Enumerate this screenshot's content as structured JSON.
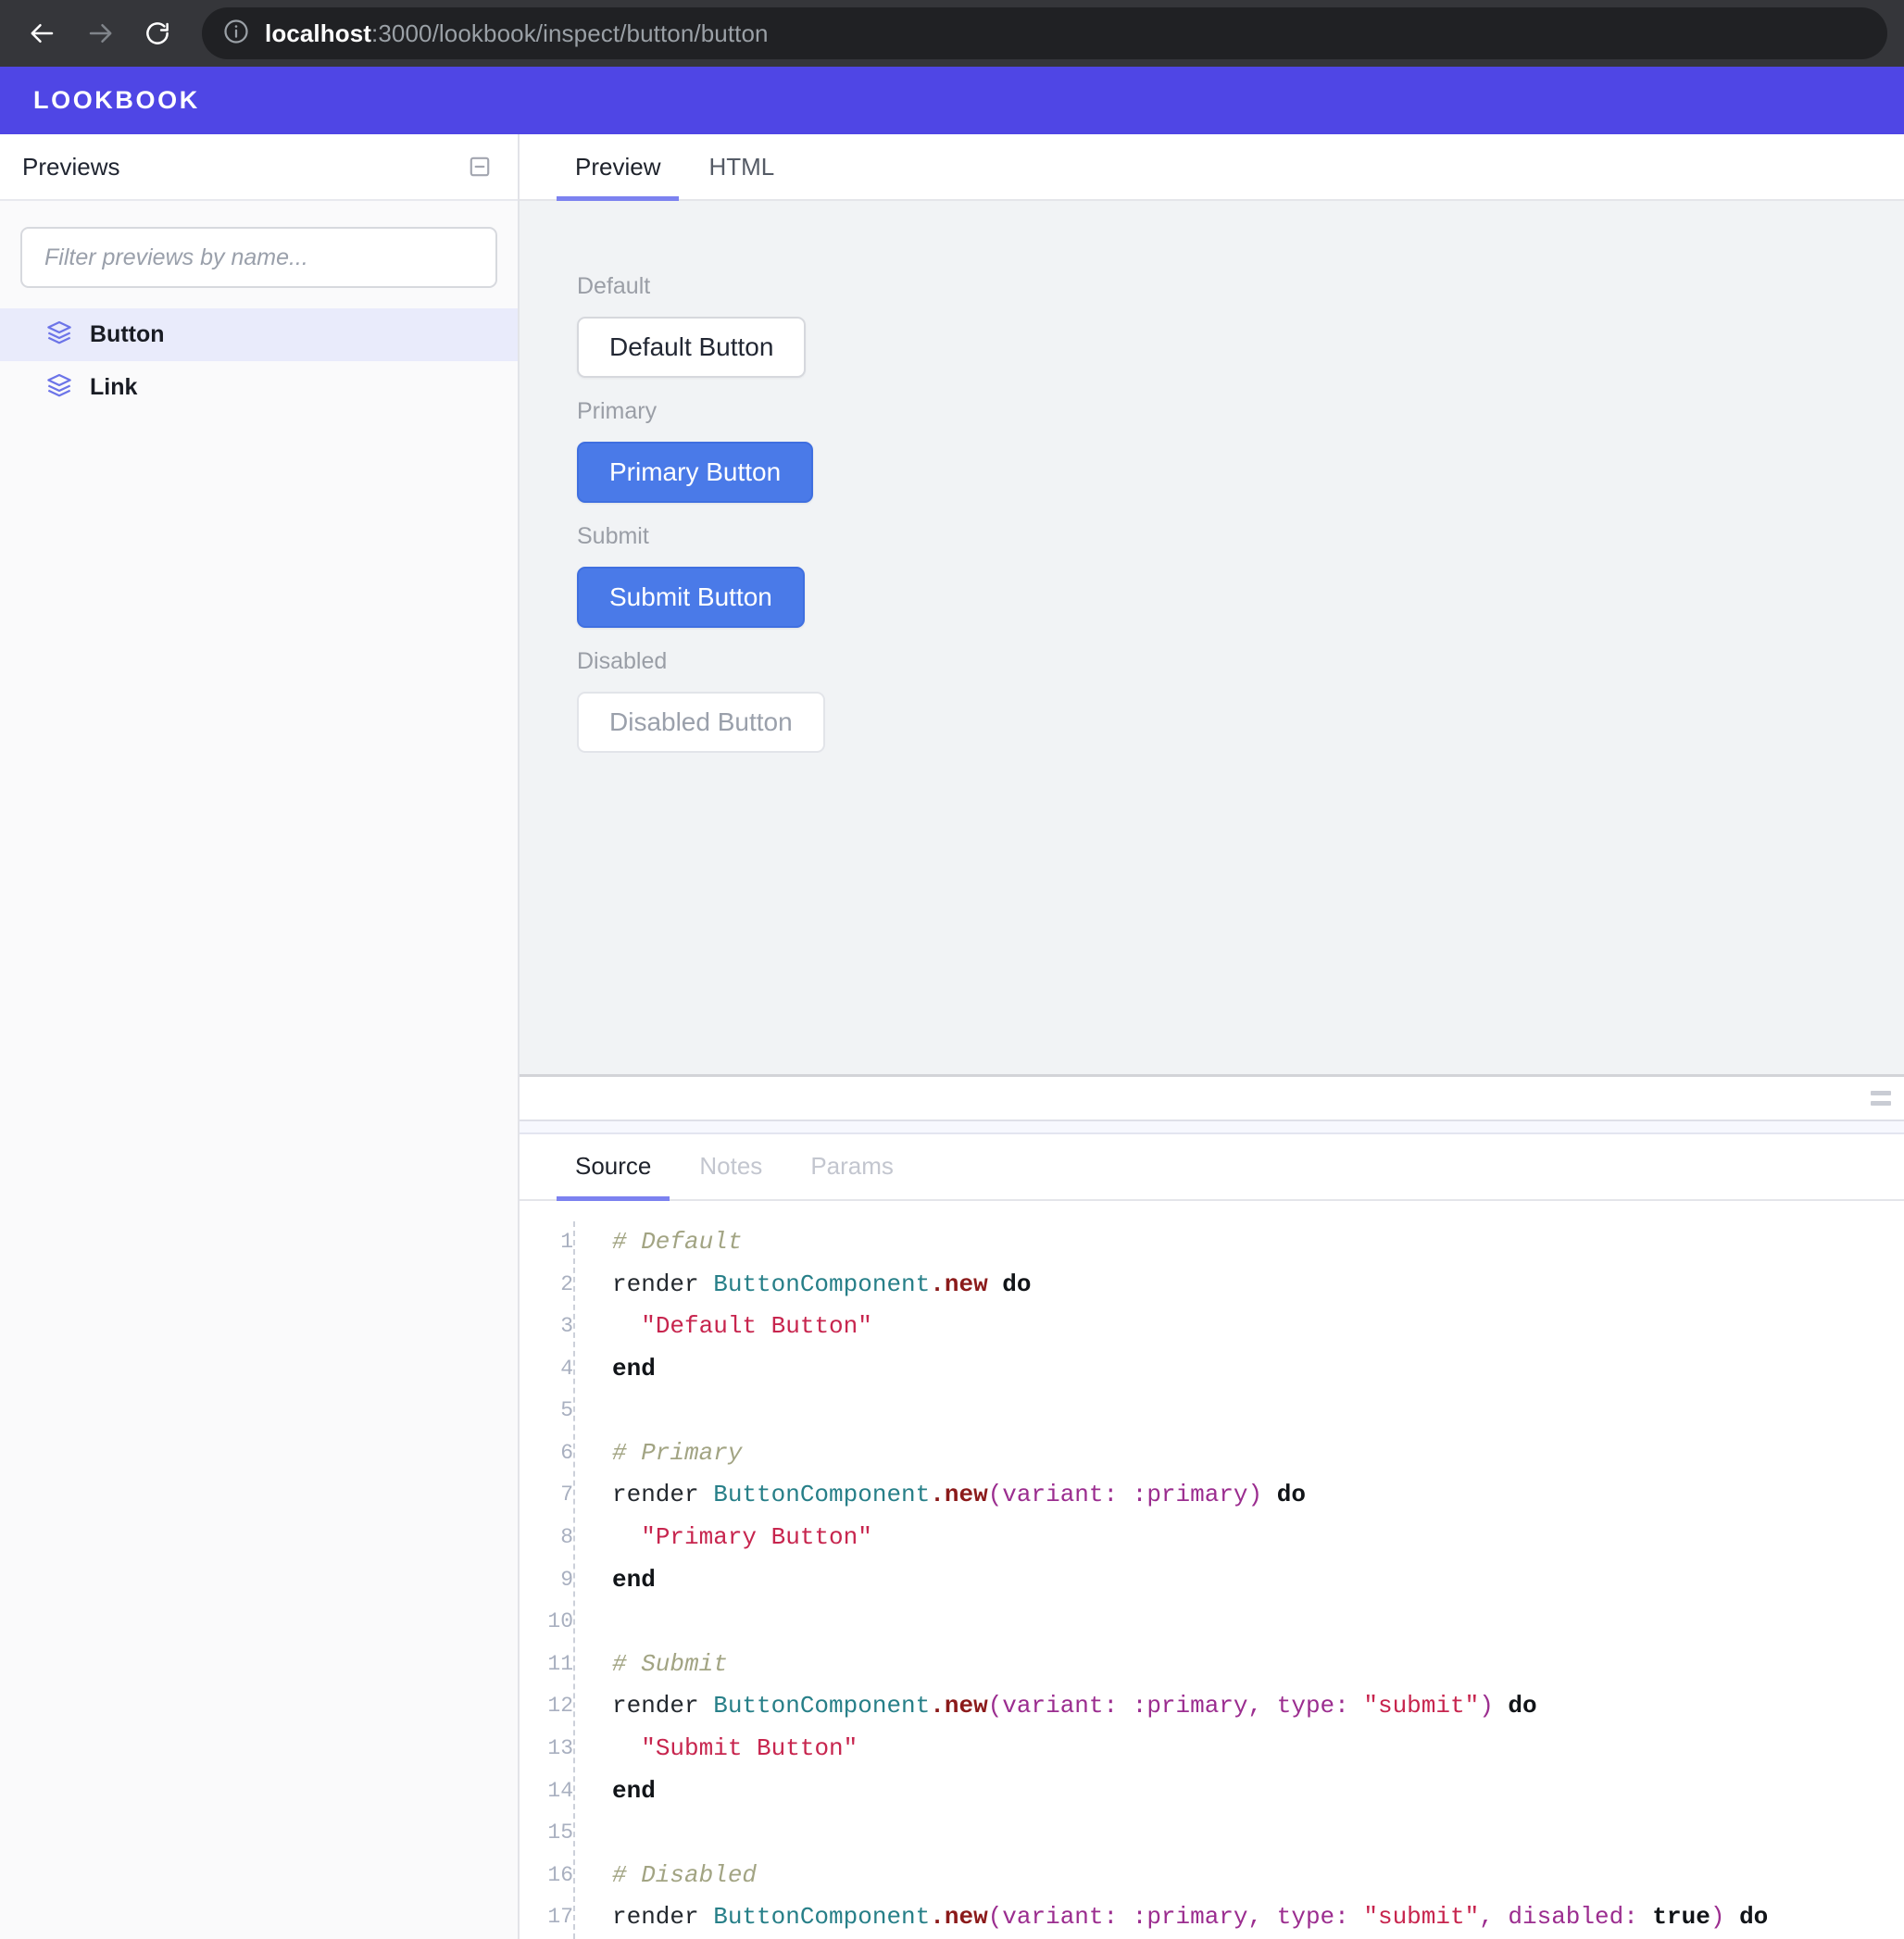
{
  "browser": {
    "back_icon": "arrow-left-icon",
    "forward_icon": "arrow-right-icon",
    "reload_icon": "reload-icon",
    "info_icon": "info-circle-icon",
    "url_host": "localhost",
    "url_rest": ":3000/lookbook/inspect/button/button"
  },
  "header": {
    "brand": "LOOKBOOK",
    "brand_color": "#4f46e5"
  },
  "sidebar": {
    "title": "Previews",
    "collapse_icon": "collapse-square-minus-icon",
    "filter_placeholder": "Filter previews by name...",
    "filter_value": "",
    "items": [
      {
        "label": "Button",
        "icon": "layers-icon",
        "active": true
      },
      {
        "label": "Link",
        "icon": "layers-icon",
        "active": false
      }
    ]
  },
  "main": {
    "tabs": [
      {
        "label": "Preview",
        "active": true
      },
      {
        "label": "HTML",
        "active": false
      }
    ],
    "previews": [
      {
        "label": "Default",
        "button_text": "Default Button",
        "style": "default"
      },
      {
        "label": "Primary",
        "button_text": "Primary Button",
        "style": "primary"
      },
      {
        "label": "Submit",
        "button_text": "Submit Button",
        "style": "primary"
      },
      {
        "label": "Disabled",
        "button_text": "Disabled Button",
        "style": "disabled"
      }
    ],
    "preview_bg": "#f1f3f5",
    "primary_button_color": "#4a7ae8"
  },
  "drawer": {
    "tabs": [
      {
        "label": "Source",
        "active": true,
        "muted": false
      },
      {
        "label": "Notes",
        "active": false,
        "muted": true
      },
      {
        "label": "Params",
        "active": false,
        "muted": true
      }
    ],
    "resize_grip_icon": "resize-grip-icon",
    "code": {
      "language": "ruby",
      "line_numbers": [
        "1",
        "2",
        "3",
        "4",
        "5",
        "6",
        "7",
        "8",
        "9",
        "10",
        "11",
        "12",
        "13",
        "14",
        "15",
        "16",
        "17"
      ],
      "lines": [
        [
          {
            "t": "comment",
            "v": "# Default"
          }
        ],
        [
          {
            "t": "plain",
            "v": "render "
          },
          {
            "t": "const",
            "v": "ButtonComponent"
          },
          {
            "t": "dot",
            "v": "."
          },
          {
            "t": "method",
            "v": "new"
          },
          {
            "t": "plain",
            "v": " "
          },
          {
            "t": "kw",
            "v": "do"
          }
        ],
        [
          {
            "t": "plain",
            "v": "  "
          },
          {
            "t": "str",
            "v": "\"Default Button\""
          }
        ],
        [
          {
            "t": "kw",
            "v": "end"
          }
        ],
        [
          {
            "t": "plain",
            "v": ""
          }
        ],
        [
          {
            "t": "comment",
            "v": "# Primary"
          }
        ],
        [
          {
            "t": "plain",
            "v": "render "
          },
          {
            "t": "const",
            "v": "ButtonComponent"
          },
          {
            "t": "dot",
            "v": "."
          },
          {
            "t": "method",
            "v": "new"
          },
          {
            "t": "sym",
            "v": "(variant: :primary)"
          },
          {
            "t": "plain",
            "v": " "
          },
          {
            "t": "kw",
            "v": "do"
          }
        ],
        [
          {
            "t": "plain",
            "v": "  "
          },
          {
            "t": "str",
            "v": "\"Primary Button\""
          }
        ],
        [
          {
            "t": "kw",
            "v": "end"
          }
        ],
        [
          {
            "t": "plain",
            "v": ""
          }
        ],
        [
          {
            "t": "comment",
            "v": "# Submit"
          }
        ],
        [
          {
            "t": "plain",
            "v": "render "
          },
          {
            "t": "const",
            "v": "ButtonComponent"
          },
          {
            "t": "dot",
            "v": "."
          },
          {
            "t": "method",
            "v": "new"
          },
          {
            "t": "sym",
            "v": "(variant: :primary, type: "
          },
          {
            "t": "str",
            "v": "\"submit\""
          },
          {
            "t": "sym",
            "v": ")"
          },
          {
            "t": "plain",
            "v": " "
          },
          {
            "t": "kw",
            "v": "do"
          }
        ],
        [
          {
            "t": "plain",
            "v": "  "
          },
          {
            "t": "str",
            "v": "\"Submit Button\""
          }
        ],
        [
          {
            "t": "kw",
            "v": "end"
          }
        ],
        [
          {
            "t": "plain",
            "v": ""
          }
        ],
        [
          {
            "t": "comment",
            "v": "# Disabled"
          }
        ],
        [
          {
            "t": "plain",
            "v": "render "
          },
          {
            "t": "const",
            "v": "ButtonComponent"
          },
          {
            "t": "dot",
            "v": "."
          },
          {
            "t": "method",
            "v": "new"
          },
          {
            "t": "sym",
            "v": "(variant: :primary, type: "
          },
          {
            "t": "str",
            "v": "\"submit\""
          },
          {
            "t": "sym",
            "v": ", disabled: "
          },
          {
            "t": "kw",
            "v": "true"
          },
          {
            "t": "sym",
            "v": ")"
          },
          {
            "t": "plain",
            "v": " "
          },
          {
            "t": "kw",
            "v": "do"
          }
        ]
      ]
    }
  }
}
